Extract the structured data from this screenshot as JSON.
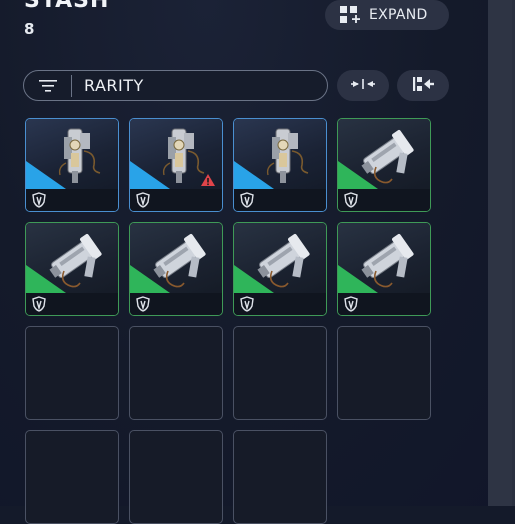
{
  "header": {
    "title": "STASH",
    "count": "8"
  },
  "toolbar": {
    "expand_label": "EXPAND",
    "sort_label": "RARITY"
  },
  "icons": {
    "expand": "grid-plus-icon",
    "sort": "filter-lines-icon",
    "collapse": "collapse-arrows-icon",
    "stack": "stack-left-icon",
    "shield": "shield-icon",
    "warning": "warning-triangle-icon"
  },
  "colors": {
    "rarity_blue": "#29a3e8",
    "rarity_green": "#2fb55a",
    "warning": "#e0444a"
  },
  "items": [
    {
      "rarity": "blue",
      "weapon": "ornate-gun-icon",
      "warning": false
    },
    {
      "rarity": "blue",
      "weapon": "ornate-gun-icon",
      "warning": true
    },
    {
      "rarity": "blue",
      "weapon": "ornate-gun-icon",
      "warning": false
    },
    {
      "rarity": "green",
      "weapon": "cannon-icon",
      "warning": false
    },
    {
      "rarity": "green",
      "weapon": "cannon-icon",
      "warning": false
    },
    {
      "rarity": "green",
      "weapon": "cannon-icon",
      "warning": false
    },
    {
      "rarity": "green",
      "weapon": "cannon-icon",
      "warning": false
    },
    {
      "rarity": "green",
      "weapon": "cannon-icon",
      "warning": false
    },
    {
      "rarity": "empty"
    },
    {
      "rarity": "empty"
    },
    {
      "rarity": "empty"
    },
    {
      "rarity": "empty"
    },
    {
      "rarity": "empty"
    },
    {
      "rarity": "empty"
    },
    {
      "rarity": "empty"
    }
  ]
}
